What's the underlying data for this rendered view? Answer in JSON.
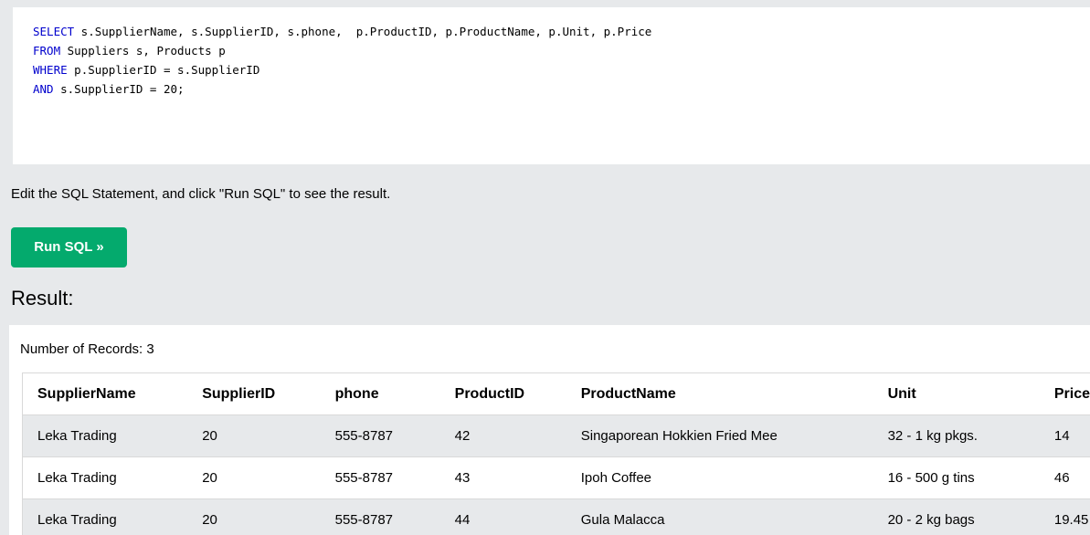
{
  "editor": {
    "lines": [
      {
        "kw": "SELECT",
        "rest": " s.SupplierName, s.SupplierID, s.phone,  p.ProductID, p.ProductName, p.Unit, p.Price"
      },
      {
        "kw": "FROM",
        "rest": " Suppliers s, Products p"
      },
      {
        "kw": "WHERE",
        "rest": " p.SupplierID = s.SupplierID"
      },
      {
        "kw": "AND",
        "rest": " s.SupplierID = 20;"
      }
    ]
  },
  "instruction": "Edit the SQL Statement, and click \"Run SQL\" to see the result.",
  "run_button": "Run SQL »",
  "result_heading": "Result:",
  "record_count": "Number of Records: 3",
  "table": {
    "headers": [
      "SupplierName",
      "SupplierID",
      "phone",
      "ProductID",
      "ProductName",
      "Unit",
      "Price"
    ],
    "rows": [
      [
        "Leka Trading",
        "20",
        "555-8787",
        "42",
        "Singaporean Hokkien Fried Mee",
        "32 - 1 kg pkgs.",
        "14"
      ],
      [
        "Leka Trading",
        "20",
        "555-8787",
        "43",
        "Ipoh Coffee",
        "16 - 500 g tins",
        "46"
      ],
      [
        "Leka Trading",
        "20",
        "555-8787",
        "44",
        "Gula Malacca",
        "20 - 2 kg bags",
        "19.45"
      ]
    ]
  },
  "colors": {
    "keyword": "#0000cd",
    "button": "#04aa6d",
    "background": "#e7e9eb"
  }
}
